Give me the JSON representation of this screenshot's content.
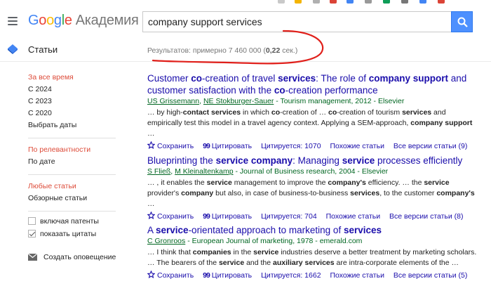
{
  "header": {
    "logo_g1": "G",
    "logo_g2": "o",
    "logo_g3": "o",
    "logo_g4": "g",
    "logo_g5": "l",
    "logo_g6": "e",
    "logo_sub": "Академия",
    "search_value": "company support services"
  },
  "subbar": {
    "section_label": "Статьи",
    "results_count": "Результатов: примерно 7 460 000 (",
    "results_time": "0,22",
    "results_unit": " сек.)"
  },
  "sidebar": {
    "time_any": "За все время",
    "time_2024": "С 2024",
    "time_2023": "С 2023",
    "time_2020": "С 2020",
    "time_custom": "Выбрать даты",
    "sort_relevance": "По релевантности",
    "sort_date": "По дате",
    "lib_favorites": "Любые статьи",
    "lib_reviews": "Обзорные статьи",
    "include_patents": "включая патенты",
    "show_citations": "показать цитаты",
    "create_alert": "Создать оповещение"
  },
  "results": [
    {
      "title_parts": [
        "Customer ",
        "co",
        "-creation of travel ",
        "services",
        ": The role of ",
        "company support",
        " and customer satisfaction with the ",
        "co",
        "-creation performance"
      ],
      "authors": [
        "US Grissemann",
        "NE Stokburger-Sauer"
      ],
      "source": " - Tourism management, 2012 - Elsevier",
      "snippet_parts": [
        "… by high-",
        "contact services",
        " in which ",
        "co",
        "-creation of … ",
        "co",
        "-creation of tourism ",
        "services",
        " and empirically test this model in a travel agency context. Applying a SEM-approach, ",
        "company support",
        " …"
      ],
      "save": "Сохранить",
      "cite": "Цитировать",
      "cited_by": "Цитируется: 1070",
      "related": "Похожие статьи",
      "versions": "Все версии статьи (9)"
    },
    {
      "title_parts": [
        "Blueprinting the ",
        "service company",
        ": Managing ",
        "service",
        " processes efficiently"
      ],
      "authors": [
        "S Fließ",
        "M Kleinaltenkamp"
      ],
      "source": " - Journal of Business research, 2004 - Elsevier",
      "snippet_parts": [
        "… , it enables the ",
        "service",
        " management to improve the ",
        "company's",
        " efficiency. … the ",
        "service",
        " provider's ",
        "company",
        " but also, in case of business-to-business ",
        "services",
        ", to the customer ",
        "company's",
        " …"
      ],
      "save": "Сохранить",
      "cite": "Цитировать",
      "cited_by": "Цитируется: 704",
      "related": "Похожие статьи",
      "versions": "Все версии статьи (8)"
    },
    {
      "title_parts": [
        "A ",
        "service",
        "-orientated approach to marketing of ",
        "services"
      ],
      "authors": [
        "C Gronroos"
      ],
      "source": " - European Journal of marketing, 1978 - emerald.com",
      "snippet_parts": [
        "… I think that ",
        "companies",
        " in the ",
        "service",
        " industries deserve a better treatment by marketing scholars. … The bearers of the ",
        "service",
        " and the ",
        "auxiliary services",
        " are intra-corporate elements of the …"
      ],
      "save": "Сохранить",
      "cite": "Цитировать",
      "cited_by": "Цитируется: 1662",
      "related": "Похожие статьи",
      "versions": "Все версии статьи (5)"
    }
  ],
  "colors": {
    "link": "#1a0dab",
    "green": "#006621",
    "active_red": "#dd4b39",
    "search_blue": "#4d90fe",
    "annotation_red": "#e0201b"
  }
}
